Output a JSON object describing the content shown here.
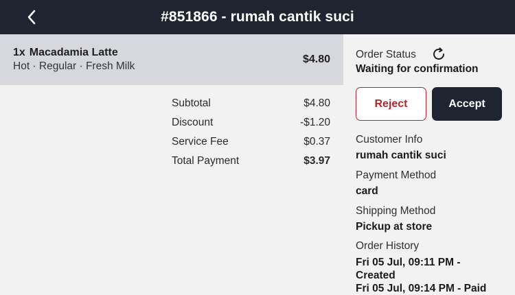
{
  "header": {
    "title": "#851866 - rumah cantik suci",
    "back_icon": "chevron-left-icon"
  },
  "order_item": {
    "quantity": "1x",
    "name": "Macadamia Latte",
    "options": "Hot · Regular · Fresh Milk",
    "price": "$4.80"
  },
  "summary": [
    {
      "label": "Subtotal",
      "value": "$4.80"
    },
    {
      "label": "Discount",
      "value": "-$1.20"
    },
    {
      "label": "Service Fee",
      "value": "$0.37"
    },
    {
      "label": "Total Payment",
      "value": "$3.97"
    }
  ],
  "status": {
    "label": "Order Status",
    "value": "Waiting for confirmation",
    "refresh_icon": "refresh-icon"
  },
  "actions": {
    "reject_label": "Reject",
    "accept_label": "Accept"
  },
  "customer": {
    "label": "Customer Info",
    "value": "rumah cantik suci"
  },
  "payment": {
    "label": "Payment Method",
    "value": "card"
  },
  "shipping": {
    "label": "Shipping Method",
    "value": "Pickup at store"
  },
  "history": {
    "label": "Order History",
    "entries": [
      "Fri 05 Jul, 09:11 PM - Created",
      "Fri 05 Jul, 09:14 PM - Paid"
    ]
  },
  "colors": {
    "header_bg": "#1f2530",
    "item_row_bg": "#d6d8de",
    "reject": "#b0272c",
    "accept_bg": "#1f2530"
  }
}
